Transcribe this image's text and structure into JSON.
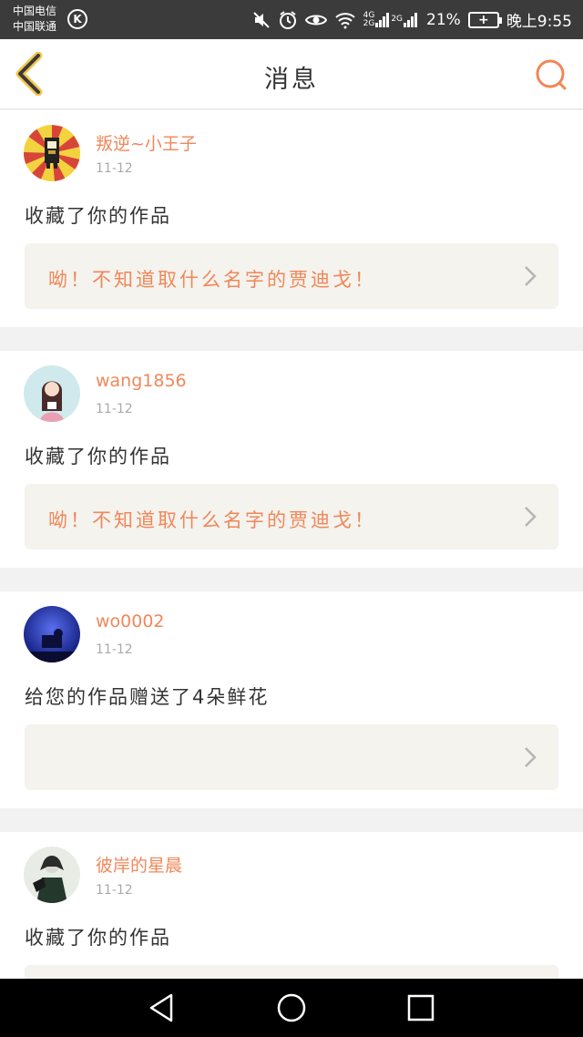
{
  "status_bar": {
    "carrier_line1": "中国电信",
    "carrier_line2": "中国联通",
    "carrier_badge": "K",
    "net_label_top": "4G",
    "net_label_bottom": "2G",
    "net_label_2": "2G",
    "battery_percent": "21%",
    "battery_icon_label": "+",
    "time": "晚上9:55",
    "icons": [
      "mute-icon",
      "alarm-icon",
      "eye-icon",
      "wifi-icon",
      "signal-icon",
      "battery-icon"
    ]
  },
  "header": {
    "title": "消息",
    "back_icon": "back-chevron-icon",
    "search_icon": "search-icon",
    "accent_color": "#f0875a"
  },
  "messages": [
    {
      "username": "叛逆~小王子",
      "date": "11-12",
      "action": "收藏了你的作品",
      "work_title": "呦！不知道取什么名字的贾迪戈！",
      "avatar": "avatar-pixel-king"
    },
    {
      "username": "wang1856",
      "date": "11-12",
      "action": "收藏了你的作品",
      "work_title": "呦！不知道取什么名字的贾迪戈！",
      "avatar": "avatar-anime-girl"
    },
    {
      "username": "wo0002",
      "date": "11-12",
      "action": "给您的作品赠送了4朵鲜花",
      "work_title": "",
      "avatar": "avatar-blue-night"
    },
    {
      "username": "彼岸的星晨",
      "date": "11-12",
      "action": "收藏了你的作品",
      "work_title": "",
      "avatar": "avatar-dark-figure"
    }
  ],
  "nav_bar": {
    "icons": [
      "back-triangle-icon",
      "home-circle-icon",
      "recents-square-icon"
    ]
  }
}
